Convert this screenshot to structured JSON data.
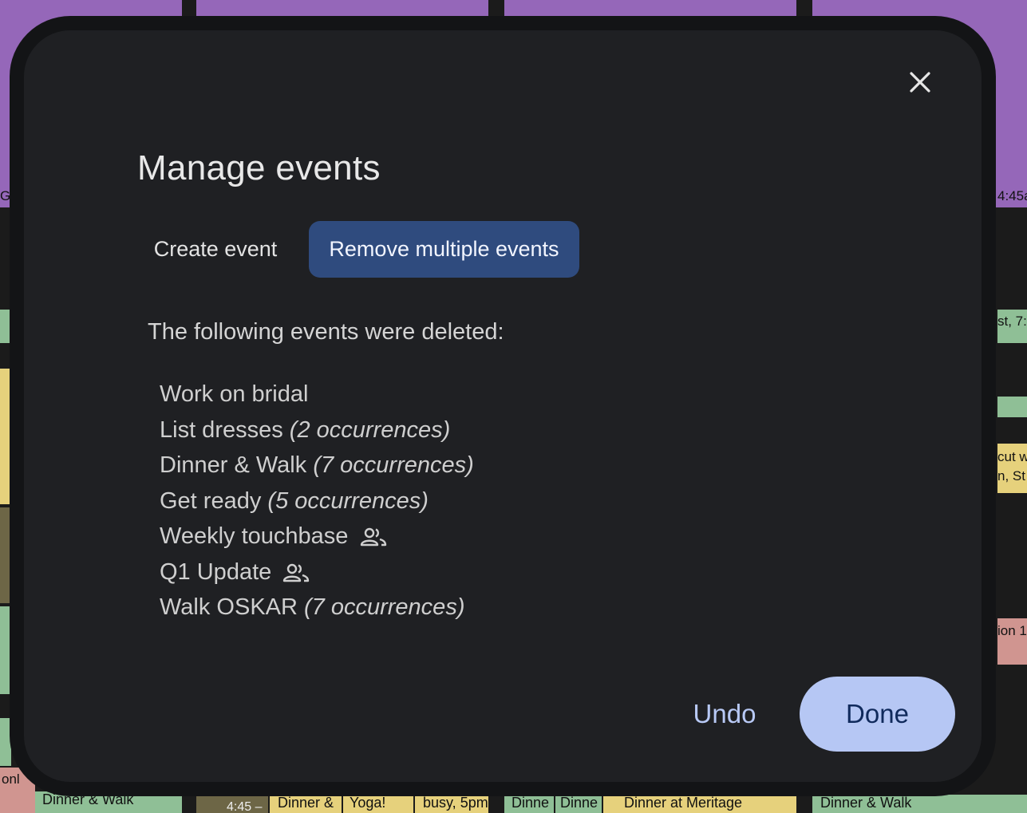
{
  "background": {
    "bottom_events": [
      "Dinner & Walk",
      "Dinner &",
      "Yoga!",
      "busy, 5pm",
      "Dinne",
      "Dinne",
      "Dinner at Meritage",
      "Dinner & Walk"
    ],
    "fragments": [
      "Ge",
      "4:45a",
      "st, 7:",
      "cut w",
      "n, St",
      "ion 1",
      "onl",
      "4:45 –"
    ]
  },
  "dialog": {
    "title": "Manage events",
    "close_icon": "close-icon",
    "tabs": [
      {
        "label": "Create event",
        "selected": false
      },
      {
        "label": "Remove multiple events",
        "selected": true
      }
    ],
    "deleted_label": "The following events were deleted:",
    "events": [
      {
        "name": "Work on bridal",
        "occurrences": "",
        "group": false
      },
      {
        "name": "List dresses",
        "occurrences": "(2 occurrences)",
        "group": false
      },
      {
        "name": "Dinner & Walk",
        "occurrences": "(7 occurrences)",
        "group": false
      },
      {
        "name": "Get ready",
        "occurrences": "(5 occurrences)",
        "group": false
      },
      {
        "name": "Weekly touchbase",
        "occurrences": "",
        "group": true
      },
      {
        "name": "Q1 Update",
        "occurrences": "",
        "group": true
      },
      {
        "name": "Walk OSKAR",
        "occurrences": "(7 occurrences)",
        "group": false
      }
    ],
    "undo_label": "Undo",
    "done_label": "Done"
  },
  "colors": {
    "accent": "#b6c7f4",
    "selected_tab": "#2f4b7e",
    "dialog_bg": "#1f2023"
  }
}
